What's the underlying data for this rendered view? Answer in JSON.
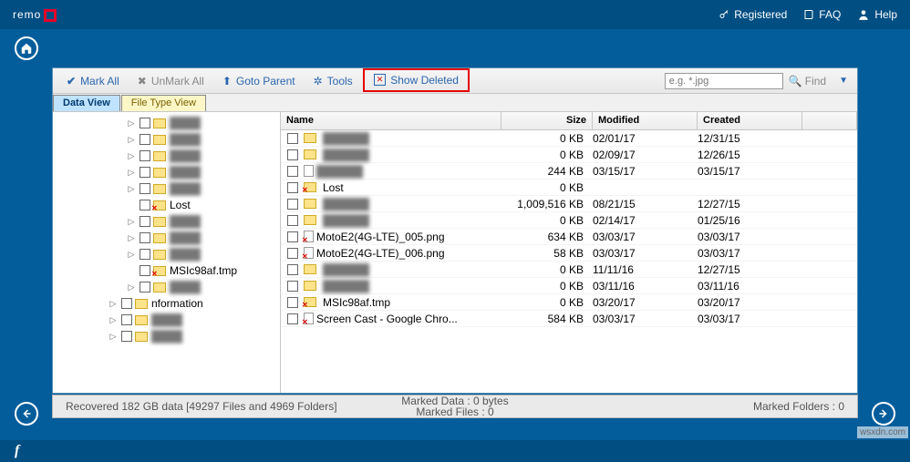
{
  "brand": "remo",
  "top": {
    "registered": "Registered",
    "faq": "FAQ",
    "help": "Help"
  },
  "toolbar": {
    "markAll": "Mark All",
    "unmarkAll": "UnMark All",
    "gotoParent": "Goto Parent",
    "tools": "Tools",
    "showDeleted": "Show Deleted",
    "find": "Find",
    "placeholder": "e.g. *.jpg"
  },
  "tabs": {
    "data": "Data View",
    "file": "File Type View"
  },
  "cols": {
    "name": "Name",
    "size": "Size",
    "mod": "Modified",
    "created": "Created"
  },
  "tree": [
    {
      "ind": 80,
      "exp": "▷",
      "label": "",
      "clear": false,
      "x": false
    },
    {
      "ind": 80,
      "exp": "▷",
      "label": "",
      "clear": false,
      "x": false
    },
    {
      "ind": 80,
      "exp": "▷",
      "label": "",
      "clear": false,
      "x": false
    },
    {
      "ind": 80,
      "exp": "▷",
      "label": "",
      "clear": false,
      "x": false
    },
    {
      "ind": 80,
      "exp": "▷",
      "label": "",
      "clear": false,
      "x": false
    },
    {
      "ind": 80,
      "exp": "",
      "label": "Lost",
      "clear": true,
      "x": true
    },
    {
      "ind": 80,
      "exp": "▷",
      "label": "",
      "clear": false,
      "x": false
    },
    {
      "ind": 80,
      "exp": "▷",
      "label": "",
      "clear": false,
      "x": false
    },
    {
      "ind": 80,
      "exp": "▷",
      "label": "",
      "clear": false,
      "x": false
    },
    {
      "ind": 80,
      "exp": "",
      "label": "MSIc98af.tmp",
      "clear": true,
      "x": true
    },
    {
      "ind": 80,
      "exp": "▷",
      "label": "",
      "clear": false,
      "x": false
    },
    {
      "ind": 60,
      "exp": "▷",
      "label": "nformation",
      "clear": true,
      "x": false,
      "pad": true
    },
    {
      "ind": 60,
      "exp": "▷",
      "label": "",
      "clear": false,
      "x": false
    },
    {
      "ind": 60,
      "exp": "▷",
      "label": "",
      "clear": false,
      "x": false
    }
  ],
  "files": [
    {
      "x": false,
      "t": "fld",
      "name": "",
      "clear": false,
      "size": "0 KB",
      "mod": "02/01/17",
      "cr": "12/31/15"
    },
    {
      "x": false,
      "t": "fld",
      "name": "",
      "clear": false,
      "size": "0 KB",
      "mod": "02/09/17",
      "cr": "12/26/15"
    },
    {
      "x": false,
      "t": "file",
      "name": "",
      "clear": false,
      "size": "244 KB",
      "mod": "03/15/17",
      "cr": "03/15/17"
    },
    {
      "x": true,
      "t": "fld",
      "name": "Lost",
      "clear": true,
      "size": "0 KB",
      "mod": "",
      "cr": ""
    },
    {
      "x": false,
      "t": "fld",
      "name": "",
      "clear": false,
      "size": "1,009,516 KB",
      "mod": "08/21/15",
      "cr": "12/27/15"
    },
    {
      "x": false,
      "t": "fld",
      "name": "",
      "clear": false,
      "size": "0 KB",
      "mod": "02/14/17",
      "cr": "01/25/16"
    },
    {
      "x": true,
      "t": "file",
      "name": "MotoE2(4G-LTE)_005.png",
      "clear": true,
      "size": "634 KB",
      "mod": "03/03/17",
      "cr": "03/03/17"
    },
    {
      "x": true,
      "t": "file",
      "name": "MotoE2(4G-LTE)_006.png",
      "clear": true,
      "size": "58 KB",
      "mod": "03/03/17",
      "cr": "03/03/17"
    },
    {
      "x": false,
      "t": "fld",
      "name": "",
      "clear": false,
      "size": "0 KB",
      "mod": "11/11/16",
      "cr": "12/27/15"
    },
    {
      "x": false,
      "t": "fld",
      "name": "",
      "clear": false,
      "size": "0 KB",
      "mod": "03/11/16",
      "cr": "03/11/16"
    },
    {
      "x": true,
      "t": "fld",
      "name": "MSIc98af.tmp",
      "clear": true,
      "size": "0 KB",
      "mod": "03/20/17",
      "cr": "03/20/17"
    },
    {
      "x": true,
      "t": "file",
      "name": "Screen Cast - Google Chro...",
      "clear": true,
      "size": "584 KB",
      "mod": "03/03/17",
      "cr": "03/03/17"
    }
  ],
  "status": {
    "left": "Recovered 182 GB data [49297 Files and 4969 Folders]",
    "markedData": "Marked Data : 0 bytes",
    "markedFiles": "Marked Files : 0",
    "markedFolders": "Marked Folders : 0"
  },
  "watermark": "wsxdn.com",
  "fb": "f"
}
